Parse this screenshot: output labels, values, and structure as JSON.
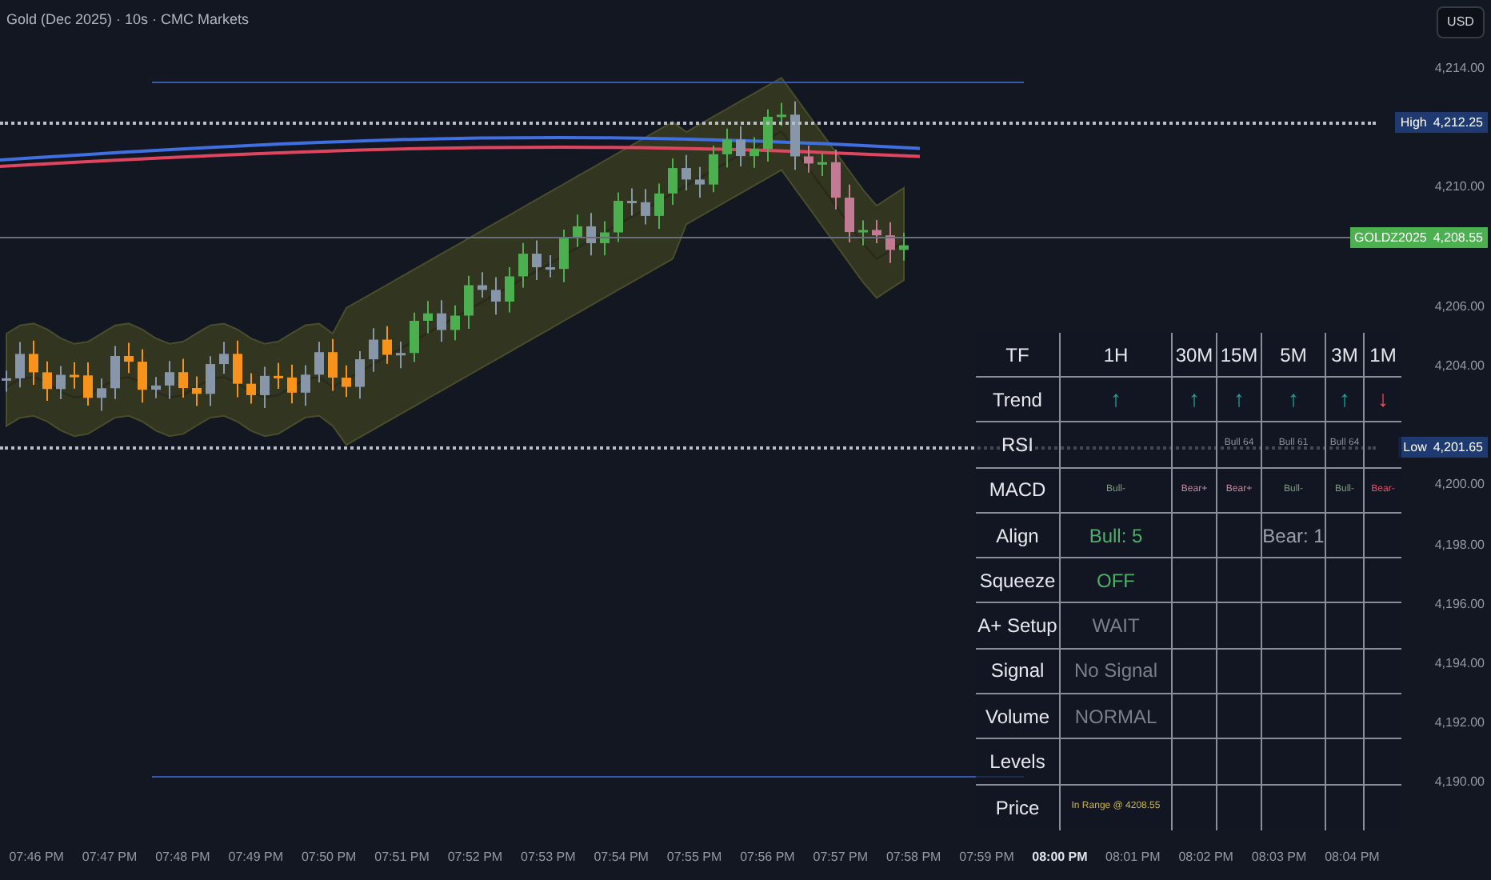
{
  "title": "Gold (Dec 2025) · 10s · CMC Markets",
  "currency_button": "USD",
  "price_ticks": [
    "4,214.00",
    "4,210.00",
    "4,206.00",
    "4,204.00",
    "4,200.00",
    "4,198.00",
    "4,196.00",
    "4,194.00",
    "4,192.00",
    "4,190.00"
  ],
  "price_labels": [
    {
      "kind": "high",
      "name": "High",
      "value": "4,212.25"
    },
    {
      "kind": "last",
      "name": "GOLDZ2025",
      "value": "4,208.55"
    },
    {
      "kind": "low",
      "name": "Low",
      "value": "4,201.65"
    }
  ],
  "time_axis": [
    {
      "label": "07:46 PM",
      "bold": false
    },
    {
      "label": "07:47 PM",
      "bold": false
    },
    {
      "label": "07:48 PM",
      "bold": false
    },
    {
      "label": "07:49 PM",
      "bold": false
    },
    {
      "label": "07:50 PM",
      "bold": false
    },
    {
      "label": "07:51 PM",
      "bold": false
    },
    {
      "label": "07:52 PM",
      "bold": false
    },
    {
      "label": "07:53 PM",
      "bold": false
    },
    {
      "label": "07:54 PM",
      "bold": false
    },
    {
      "label": "07:55 PM",
      "bold": false
    },
    {
      "label": "07:56 PM",
      "bold": false
    },
    {
      "label": "07:57 PM",
      "bold": false
    },
    {
      "label": "07:58 PM",
      "bold": false
    },
    {
      "label": "07:59 PM",
      "bold": false
    },
    {
      "label": "08:00 PM",
      "bold": true
    },
    {
      "label": "08:01 PM",
      "bold": false
    },
    {
      "label": "08:02 PM",
      "bold": false
    },
    {
      "label": "08:03 PM",
      "bold": false
    },
    {
      "label": "08:04 PM",
      "bold": false
    }
  ],
  "table": {
    "header": [
      "TF",
      "1H",
      "30M",
      "15M",
      "5M",
      "3M",
      "1M"
    ],
    "rows": [
      {
        "label": "Trend",
        "kind": "arrow",
        "cells": [
          {
            "text": "↑",
            "color": "#26a69a"
          },
          {
            "text": "↑",
            "color": "#26a69a"
          },
          {
            "text": "↑",
            "color": "#26a69a"
          },
          {
            "text": "↑",
            "color": "#26a69a"
          },
          {
            "text": "↑",
            "color": "#26a69a"
          },
          {
            "text": "↓",
            "color": "#ef5350"
          }
        ]
      },
      {
        "label": "RSI",
        "kind": "tiny",
        "cells": [
          {},
          {},
          {
            "text": "Bull 64",
            "color": "#8a8f9a"
          },
          {
            "text": "Bull 61",
            "color": "#8a8f9a"
          },
          {
            "text": "Bull 64",
            "color": "#8a8f9a"
          },
          {}
        ]
      },
      {
        "label": "MACD",
        "kind": "tiny",
        "cells": [
          {
            "text": "Bull-",
            "color": "#7f9a7f"
          },
          {
            "text": "Bear+",
            "color": "#c08a9a"
          },
          {
            "text": "Bear+",
            "color": "#c08a9a"
          },
          {
            "text": "Bull-",
            "color": "#7f9a7f"
          },
          {
            "text": "Bull-",
            "color": "#7f9a7f"
          },
          {
            "text": "Bear-",
            "color": "#e0506a"
          }
        ]
      },
      {
        "label": "Align",
        "kind": "normal",
        "cells": [
          {
            "text": "Bull: 5",
            "color": "#4caf6a"
          },
          {},
          {},
          {
            "text": "Bear: 1",
            "color": "#9aa0aa"
          },
          {},
          {}
        ]
      },
      {
        "label": "Squeeze",
        "kind": "normal",
        "cells": [
          {
            "text": "OFF",
            "color": "#4caf6a"
          },
          {},
          {},
          {},
          {},
          {}
        ]
      },
      {
        "label": "A+ Setup",
        "kind": "normal",
        "cells": [
          {
            "text": "WAIT",
            "color": "#7a7f8a"
          },
          {},
          {},
          {},
          {},
          {}
        ]
      },
      {
        "label": "Signal",
        "kind": "normal",
        "cells": [
          {
            "text": "No Signal",
            "color": "#7a7f8a"
          },
          {},
          {},
          {},
          {},
          {}
        ]
      },
      {
        "label": "Volume",
        "kind": "normal",
        "cells": [
          {
            "text": "NORMAL",
            "color": "#7a7f8a"
          },
          {},
          {},
          {},
          {},
          {}
        ]
      },
      {
        "label": "Levels",
        "cells": [
          {},
          {},
          {},
          {},
          {},
          {}
        ]
      },
      {
        "label": "Price",
        "kind": "tiny",
        "cells": [
          {
            "text": "In Range @ 4208.55",
            "color": "#c8b44a"
          },
          {},
          {},
          {},
          {},
          {}
        ]
      }
    ]
  }
}
